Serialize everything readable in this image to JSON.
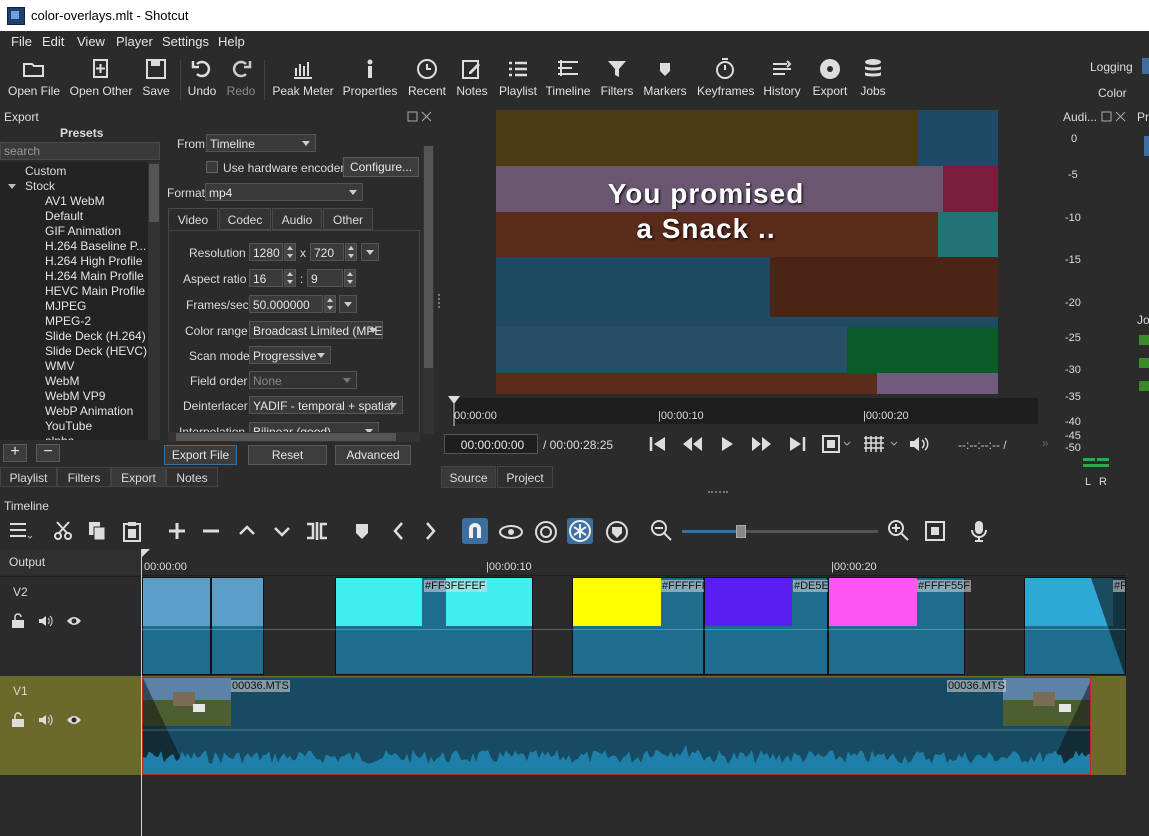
{
  "window": {
    "title": "color-overlays.mlt - Shotcut"
  },
  "menu": [
    "File",
    "Edit",
    "View",
    "Player",
    "Settings",
    "Help"
  ],
  "toolbar": {
    "items": [
      "Open File",
      "Open Other",
      "Save",
      "Undo",
      "Redo",
      "Peak Meter",
      "Properties",
      "Recent",
      "Notes",
      "Playlist",
      "Timeline",
      "Filters",
      "Markers",
      "Keyframes",
      "History",
      "Export",
      "Jobs"
    ],
    "layouts": [
      "Logging",
      "Color"
    ]
  },
  "export": {
    "title": "Export",
    "presets_title": "Presets",
    "search_placeholder": "search",
    "tree": {
      "custom": "Custom",
      "stock": "Stock"
    },
    "presets": [
      "AV1 WebM",
      "Default",
      "GIF Animation",
      "H.264 Baseline P...",
      "H.264 High Profile",
      "H.264 Main Profile",
      "HEVC Main Profile",
      "MJPEG",
      "MPEG-2",
      "Slide Deck (H.264)",
      "Slide Deck (HEVC)",
      "WMV",
      "WebM",
      "WebM VP9",
      "WebP Animation",
      "YouTube",
      "alpha"
    ],
    "from_label": "From",
    "from_value": "Timeline",
    "hw_encoder_label": "Use hardware encoder",
    "configure_label": "Configure...",
    "format_label": "Format",
    "format_value": "mp4",
    "tabs": [
      "Video",
      "Codec",
      "Audio",
      "Other"
    ],
    "resolution_label": "Resolution",
    "res_w": "1280",
    "res_x": "x",
    "res_h": "720",
    "aspect_label": "Aspect ratio",
    "aspect_w": "16",
    "aspect_sep": ":",
    "aspect_h": "9",
    "fps_label": "Frames/sec",
    "fps_value": "50.000000",
    "color_range_label": "Color range",
    "color_range_value": "Broadcast Limited (MPE",
    "scan_mode_label": "Scan mode",
    "scan_mode_value": "Progressive",
    "field_order_label": "Field order",
    "field_order_value": "None",
    "deinterlacer_label": "Deinterlacer",
    "deinterlacer_value": "YADIF - temporal + spatial",
    "interpolation_label": "Interpolation",
    "interpolation_value": "Bilinear (good)",
    "buttons": {
      "export_file": "Export File",
      "reset": "Reset",
      "advanced": "Advanced"
    }
  },
  "left_tabs": [
    "Playlist",
    "Filters",
    "Export",
    "Notes"
  ],
  "player": {
    "overlay_line1": "You promised",
    "overlay_line2": "a Snack ..",
    "ruler": [
      "00:00:00",
      "|00:00:10",
      "|00:00:20"
    ],
    "timecode": "00:00:00:00",
    "duration": "/ 00:00:28:25",
    "inout": "--:--:--:-- /",
    "tabs": [
      "Source",
      "Project"
    ]
  },
  "audio_meter": {
    "title": "Audi...",
    "scale": [
      "0",
      "-5",
      "-10",
      "-15",
      "-20",
      "-25",
      "-30",
      "-35",
      "-40",
      "-45",
      "-50"
    ],
    "channels": [
      "L",
      "R"
    ]
  },
  "right_panel": {
    "title_fragment": "Pr",
    "jobs_fragment": "Jo"
  },
  "timeline": {
    "title": "Timeline",
    "ruler": [
      "00:00:00",
      "|00:00:10",
      "|00:00:20"
    ],
    "output_label": "Output",
    "tracks": [
      "V2",
      "V1"
    ],
    "clip_labels": {
      "c1": "#FF3FEFEF",
      "c2": "#FFFFFF",
      "c3": "#DE5E",
      "c4": "#FFFF55F",
      "c5": "#F",
      "v1a": "00036.MTS",
      "v1b": "00036.MTS"
    }
  },
  "colors": {
    "accent": "#3b6fa0",
    "v1_track": "#6b6a2a",
    "clip_audio": "#1e6d8f"
  }
}
